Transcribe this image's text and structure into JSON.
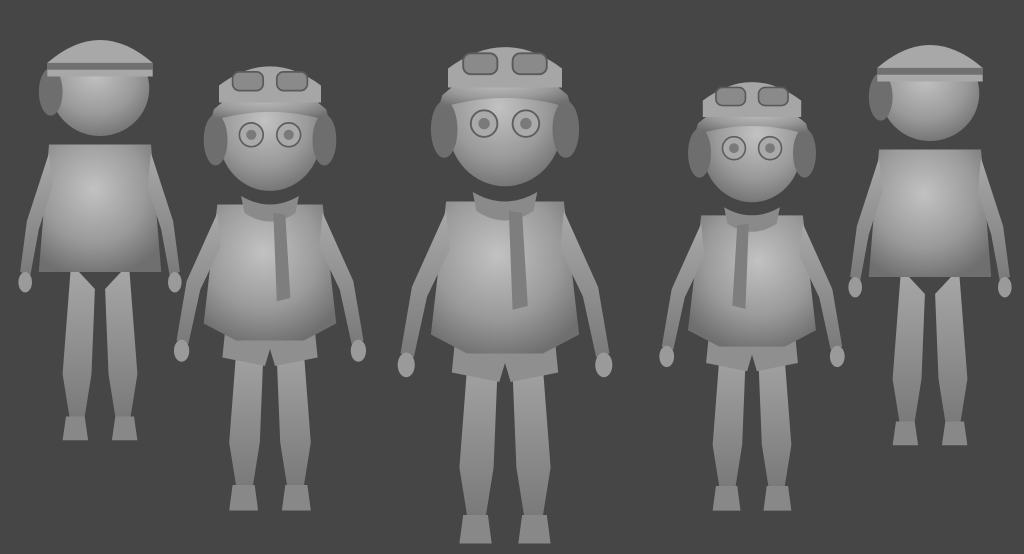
{
  "scene": {
    "background": "#464646",
    "clay": "#9c9c9c",
    "clay_light": "#b8b8b8",
    "clay_dark": "#6a6a6a",
    "views": [
      {
        "name": "back-left",
        "facing": "back"
      },
      {
        "name": "side-left",
        "facing": "three-quarter-left"
      },
      {
        "name": "front",
        "facing": "front"
      },
      {
        "name": "side-right",
        "facing": "three-quarter-right"
      },
      {
        "name": "back-right",
        "facing": "back"
      }
    ]
  }
}
